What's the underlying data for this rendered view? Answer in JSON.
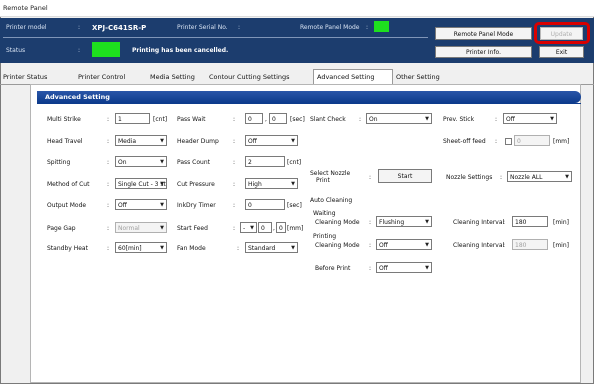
{
  "window": {
    "title": "Remote Panel"
  },
  "info": {
    "printer_model_label": "Printer model",
    "printer_model_value": "XPJ-C641SR-P",
    "printer_serial_label": "Printer Serial No.",
    "remote_panel_mode_label": "Remote Panel Mode",
    "status_label": "Status",
    "status_message": "Printing has been cancelled.",
    "status_color": "#1ee01e",
    "mode_color": "#1ee01e"
  },
  "buttons": {
    "remote_panel_mode": "Remote Panel Mode",
    "update": "Update",
    "printer_info": "Printer Info.",
    "exit": "Exit"
  },
  "tabs": [
    "Printer Status",
    "Printer Control",
    "Media Setting",
    "Contour Cutting Settings",
    "Advanced Setting",
    "Other Setting"
  ],
  "active_tab": "Advanced Setting",
  "section_title": "Advanced Setting",
  "settings": {
    "multi_strike": {
      "label": "Multi Strike",
      "value": "1",
      "unit": "[cnt]"
    },
    "head_travel": {
      "label": "Head Travel",
      "value": "Media"
    },
    "spitting": {
      "label": "Spitting",
      "value": "On"
    },
    "method_of_cut": {
      "label": "Method of Cut",
      "value": "Single Cut - 3 str"
    },
    "output_mode": {
      "label": "Output Mode",
      "value": "Off"
    },
    "page_gap": {
      "label": "Page Gap",
      "value": "Normal"
    },
    "standby_heat": {
      "label": "Standby Heat",
      "value": "60[min]"
    },
    "pass_wait": {
      "label": "Pass Wait",
      "value1": "0",
      "value2": "0",
      "unit": "[sec]"
    },
    "header_dump": {
      "label": "Header Dump",
      "value": "Off"
    },
    "pass_count": {
      "label": "Pass Count",
      "value": "2",
      "unit": "[cnt]"
    },
    "cut_pressure": {
      "label": "Cut Pressure",
      "value": "High"
    },
    "ink_dry_timer": {
      "label": "InkDry Timer",
      "value": "0",
      "unit": "[sec]"
    },
    "start_feed": {
      "label": "Start Feed",
      "sign": "-",
      "value1": "0",
      "value2": "0",
      "unit": "[mm]"
    },
    "fan_mode": {
      "label": "Fan Mode",
      "value": "Standard"
    },
    "slant_check": {
      "label": "Slant Check",
      "value": "On"
    },
    "select_nozzle_print_label_1": "Select Nozzle",
    "select_nozzle_print_label_2": "Print",
    "start_button": "Start",
    "auto_cleaning": "Auto Cleaning",
    "waiting_label": "Waiting",
    "waiting_cleaning_mode_label": "Cleaning Mode",
    "waiting_cleaning_mode": "Flushing",
    "printing_label": "Printing",
    "printing_cleaning_mode_label": "Cleaning Mode",
    "printing_cleaning_mode": "Off",
    "before_print_label": "Before Print",
    "before_print": "Off",
    "prev_stick": {
      "label": "Prev. Stick",
      "value": "Off"
    },
    "sheet_off_feed": {
      "label": "Sheet-off feed",
      "value": "0",
      "unit": "[mm]"
    },
    "nozzle_settings": {
      "label": "Nozzle Settings",
      "value": "Nozzle ALL"
    },
    "waiting_interval": {
      "label": "Cleaning Interval",
      "value": "180",
      "unit": "[min]"
    },
    "printing_interval": {
      "label": "Cleaning Interval",
      "value": "180",
      "unit": "[min]"
    }
  }
}
